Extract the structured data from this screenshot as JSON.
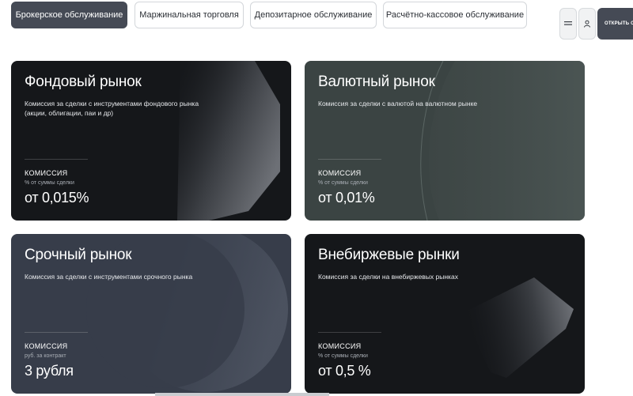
{
  "tabs": [
    {
      "label": "Брокерское обслуживание"
    },
    {
      "label": "Маржинальная торговля"
    },
    {
      "label": "Депозитарное обслуживание"
    },
    {
      "label": "Расчётно-кассовое обслуживание"
    }
  ],
  "header": {
    "menu_icon": "menu-icon",
    "user_icon": "user-icon",
    "open_button": "ОТКРЫТЬ СЧЁТ"
  },
  "cards": [
    {
      "title": "Фондовый рынок",
      "description": "Комиссия за сделки с инструментами фондового рынка (акции, облигации, паи и др)",
      "label": "КОМИССИЯ",
      "sublabel": "% от суммы сделки",
      "value": "от 0,015%",
      "bg": "#15171a"
    },
    {
      "title": "Валютный рынок",
      "description": "Комиссия за сделки с валютой на валютном рынке",
      "label": "КОМИССИЯ",
      "sublabel": "% от суммы сделки",
      "value": "от 0,01%",
      "bg": "#3b4443"
    },
    {
      "title": "Срочный рынок",
      "description": "Комиссия за сделки с инструментами срочного рынка",
      "label": "КОМИССИЯ",
      "sublabel": "руб. за контракт",
      "value": "3 рубля",
      "bg": "#373d4a"
    },
    {
      "title": "Внебиржевые рынки",
      "description": "Комиссия за сделки на внебиржевых рынках",
      "label": "КОМИССИЯ",
      "sublabel": "% от суммы сделки",
      "value": "от 0,5 %",
      "bg": "#15171a"
    }
  ]
}
